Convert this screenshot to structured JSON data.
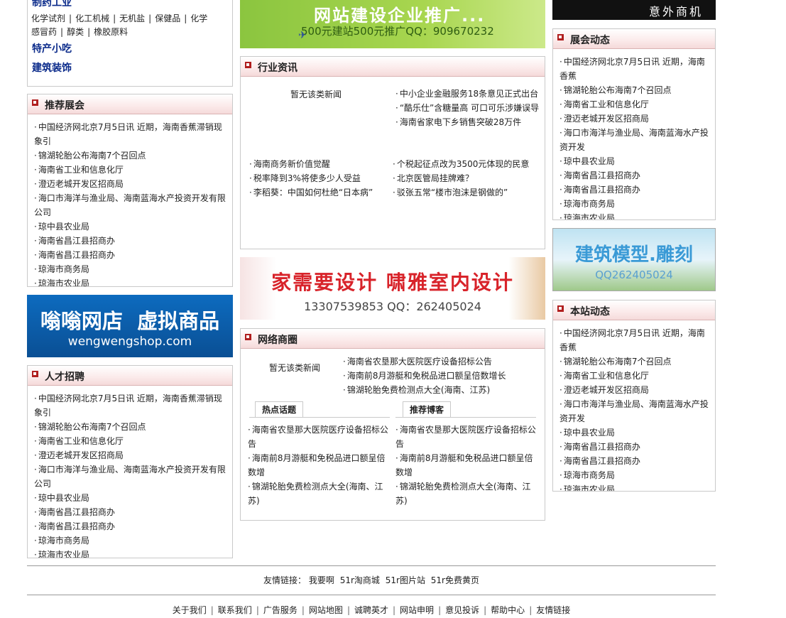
{
  "top_left": {
    "category_heading": "制药工业",
    "sub_links": [
      "化学试剂",
      "化工机械",
      "无机盐",
      "保健品",
      "化学",
      "感冒药",
      "醇类",
      "橡胶原料"
    ],
    "heading_2": "特产小吃",
    "heading_3": "建筑装饰"
  },
  "banners": {
    "top_center_line1": "网站建设企业推广...",
    "top_center_line2": "500元建站500元推广QQ：909670232",
    "top_right": "意外商机",
    "left_mid_line1": "嗡嗡网店  虚拟商品",
    "left_mid_line2": "wengwengshop.com",
    "center_mid_line1": "家需要设计 啸雅室内设计",
    "center_mid_line2": "13307539853 QQ：262405024",
    "right_mid_line1": "建筑模型.雕刻",
    "right_mid_line2": "QQ262405024"
  },
  "news_list": [
    "中国经济网北京7月5日讯 近期，海南香蕉滞销现象引",
    "锦湖轮胎公布海南7个召回点",
    "海南省工业和信息化厅",
    "澄迈老城开发区招商局",
    "海口市海洋与渔业局、海南蓝海水产投资开发有限公司",
    "琼中县农业局",
    "海南省昌江县招商办",
    "海南省昌江县招商办",
    "琼海市商务局",
    "琼海市农业局"
  ],
  "recommend_expo": {
    "title": "推荐展会"
  },
  "talent": {
    "title": "人才招聘"
  },
  "expo_news": {
    "title": "展会动态",
    "items": [
      "中国经济网北京7月5日讯 近期，海南香蕉",
      "锦湖轮胎公布海南7个召回点",
      "海南省工业和信息化厅",
      "澄迈老城开发区招商局",
      "海口市海洋与渔业局、海南蓝海水产投资开发",
      "琼中县农业局",
      "海南省昌江县招商办",
      "海南省昌江县招商办",
      "琼海市商务局",
      "琼海市农业局"
    ]
  },
  "site_news": {
    "title": "本站动态"
  },
  "industry": {
    "title": "行业资讯",
    "empty": "暂无该类新闻",
    "right_items": [
      "中小企业金融服务18条意见正式出台",
      "“酷乐仕”含糖量高 可口可乐涉嫌误导",
      "海南省家电下乡销售突破28万件"
    ],
    "left_bottom": [
      "海南商务新价值觉醒",
      "税率降到3%将使多少人受益",
      "李稻葵：中国如何杜绝“日本病”"
    ],
    "right_bottom": [
      "个税起征点改为3500元体现的民意",
      "北京医管局挂牌难？",
      "驳张五常“楼市泡沫是钢做的”"
    ]
  },
  "network": {
    "title": "网络商圈",
    "empty": "暂无该类新闻",
    "top_items": [
      "海南省农垦那大医院医疗设备招标公告",
      "海南前8月游艇和免税品进口额呈倍数增长",
      "锦湖轮胎免费检测点大全(海南、江苏)"
    ],
    "tab_hot": "热点话题",
    "tab_blog": "推荐博客",
    "hot_items": [
      "海南省农垦那大医院医疗设备招标公告",
      "海南前8月游艇和免税品进口额呈倍数增",
      "锦湖轮胎免费检测点大全(海南、江苏)"
    ],
    "blog_items": [
      "海南省农垦那大医院医疗设备招标公告",
      "海南前8月游艇和免税品进口额呈倍数增",
      "锦湖轮胎免费检测点大全(海南、江苏)"
    ]
  },
  "friend_links": {
    "label": "友情链接：",
    "items": [
      "我要啊",
      "51r淘商城",
      "51r图片站",
      "51r免费黄页"
    ]
  },
  "footer": {
    "items": [
      "关于我们",
      "联系我们",
      "广告服务",
      "网站地图",
      "诚聘英才",
      "网站申明",
      "意见投诉",
      "帮助中心",
      "友情链接"
    ]
  },
  "colors": {
    "accent_red": "#b01e1e",
    "link_blue": "#0a2a8a",
    "banner_green": "#8bc53f",
    "banner_blue": "#0b5fae"
  }
}
